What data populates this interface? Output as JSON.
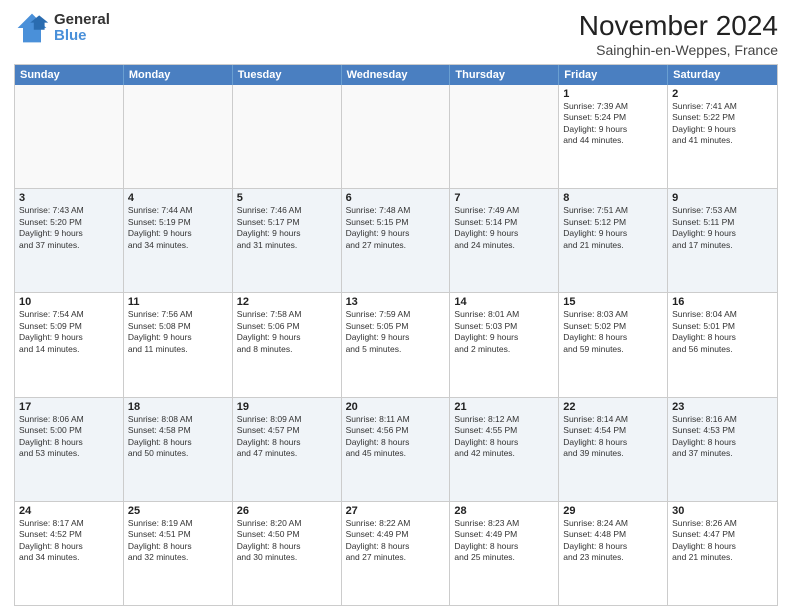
{
  "logo": {
    "general": "General",
    "blue": "Blue"
  },
  "title": "November 2024",
  "subtitle": "Sainghin-en-Weppes, France",
  "header_days": [
    "Sunday",
    "Monday",
    "Tuesday",
    "Wednesday",
    "Thursday",
    "Friday",
    "Saturday"
  ],
  "rows": [
    [
      {
        "day": "",
        "info": ""
      },
      {
        "day": "",
        "info": ""
      },
      {
        "day": "",
        "info": ""
      },
      {
        "day": "",
        "info": ""
      },
      {
        "day": "",
        "info": ""
      },
      {
        "day": "1",
        "info": "Sunrise: 7:39 AM\nSunset: 5:24 PM\nDaylight: 9 hours\nand 44 minutes."
      },
      {
        "day": "2",
        "info": "Sunrise: 7:41 AM\nSunset: 5:22 PM\nDaylight: 9 hours\nand 41 minutes."
      }
    ],
    [
      {
        "day": "3",
        "info": "Sunrise: 7:43 AM\nSunset: 5:20 PM\nDaylight: 9 hours\nand 37 minutes."
      },
      {
        "day": "4",
        "info": "Sunrise: 7:44 AM\nSunset: 5:19 PM\nDaylight: 9 hours\nand 34 minutes."
      },
      {
        "day": "5",
        "info": "Sunrise: 7:46 AM\nSunset: 5:17 PM\nDaylight: 9 hours\nand 31 minutes."
      },
      {
        "day": "6",
        "info": "Sunrise: 7:48 AM\nSunset: 5:15 PM\nDaylight: 9 hours\nand 27 minutes."
      },
      {
        "day": "7",
        "info": "Sunrise: 7:49 AM\nSunset: 5:14 PM\nDaylight: 9 hours\nand 24 minutes."
      },
      {
        "day": "8",
        "info": "Sunrise: 7:51 AM\nSunset: 5:12 PM\nDaylight: 9 hours\nand 21 minutes."
      },
      {
        "day": "9",
        "info": "Sunrise: 7:53 AM\nSunset: 5:11 PM\nDaylight: 9 hours\nand 17 minutes."
      }
    ],
    [
      {
        "day": "10",
        "info": "Sunrise: 7:54 AM\nSunset: 5:09 PM\nDaylight: 9 hours\nand 14 minutes."
      },
      {
        "day": "11",
        "info": "Sunrise: 7:56 AM\nSunset: 5:08 PM\nDaylight: 9 hours\nand 11 minutes."
      },
      {
        "day": "12",
        "info": "Sunrise: 7:58 AM\nSunset: 5:06 PM\nDaylight: 9 hours\nand 8 minutes."
      },
      {
        "day": "13",
        "info": "Sunrise: 7:59 AM\nSunset: 5:05 PM\nDaylight: 9 hours\nand 5 minutes."
      },
      {
        "day": "14",
        "info": "Sunrise: 8:01 AM\nSunset: 5:03 PM\nDaylight: 9 hours\nand 2 minutes."
      },
      {
        "day": "15",
        "info": "Sunrise: 8:03 AM\nSunset: 5:02 PM\nDaylight: 8 hours\nand 59 minutes."
      },
      {
        "day": "16",
        "info": "Sunrise: 8:04 AM\nSunset: 5:01 PM\nDaylight: 8 hours\nand 56 minutes."
      }
    ],
    [
      {
        "day": "17",
        "info": "Sunrise: 8:06 AM\nSunset: 5:00 PM\nDaylight: 8 hours\nand 53 minutes."
      },
      {
        "day": "18",
        "info": "Sunrise: 8:08 AM\nSunset: 4:58 PM\nDaylight: 8 hours\nand 50 minutes."
      },
      {
        "day": "19",
        "info": "Sunrise: 8:09 AM\nSunset: 4:57 PM\nDaylight: 8 hours\nand 47 minutes."
      },
      {
        "day": "20",
        "info": "Sunrise: 8:11 AM\nSunset: 4:56 PM\nDaylight: 8 hours\nand 45 minutes."
      },
      {
        "day": "21",
        "info": "Sunrise: 8:12 AM\nSunset: 4:55 PM\nDaylight: 8 hours\nand 42 minutes."
      },
      {
        "day": "22",
        "info": "Sunrise: 8:14 AM\nSunset: 4:54 PM\nDaylight: 8 hours\nand 39 minutes."
      },
      {
        "day": "23",
        "info": "Sunrise: 8:16 AM\nSunset: 4:53 PM\nDaylight: 8 hours\nand 37 minutes."
      }
    ],
    [
      {
        "day": "24",
        "info": "Sunrise: 8:17 AM\nSunset: 4:52 PM\nDaylight: 8 hours\nand 34 minutes."
      },
      {
        "day": "25",
        "info": "Sunrise: 8:19 AM\nSunset: 4:51 PM\nDaylight: 8 hours\nand 32 minutes."
      },
      {
        "day": "26",
        "info": "Sunrise: 8:20 AM\nSunset: 4:50 PM\nDaylight: 8 hours\nand 30 minutes."
      },
      {
        "day": "27",
        "info": "Sunrise: 8:22 AM\nSunset: 4:49 PM\nDaylight: 8 hours\nand 27 minutes."
      },
      {
        "day": "28",
        "info": "Sunrise: 8:23 AM\nSunset: 4:49 PM\nDaylight: 8 hours\nand 25 minutes."
      },
      {
        "day": "29",
        "info": "Sunrise: 8:24 AM\nSunset: 4:48 PM\nDaylight: 8 hours\nand 23 minutes."
      },
      {
        "day": "30",
        "info": "Sunrise: 8:26 AM\nSunset: 4:47 PM\nDaylight: 8 hours\nand 21 minutes."
      }
    ]
  ]
}
